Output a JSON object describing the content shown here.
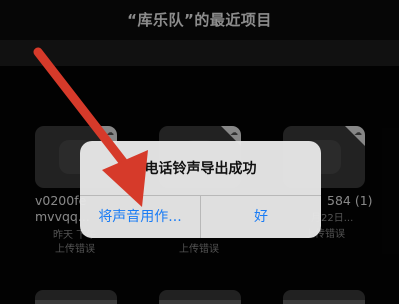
{
  "header": {
    "title": "“库乐队”的最近项目"
  },
  "files": [
    {
      "name": "v0200fe",
      "name2": "mvvqq...",
      "date": "昨天 下午",
      "status": "上传错误"
    },
    {
      "name": "",
      "name2": "",
      "date": "",
      "status": "上传错误"
    },
    {
      "name": "584 (1)",
      "name2": "",
      "date": "月22日...",
      "status": "上传错误"
    }
  ],
  "alert": {
    "title": "电话铃声导出成功",
    "left_button": "将声音用作...",
    "right_button": "好"
  },
  "colors": {
    "accent": "#1a7cf5",
    "arrow": "#d63a2a",
    "background": "#050505"
  },
  "icons": [
    "guitar-icon",
    "cloud-icon"
  ]
}
